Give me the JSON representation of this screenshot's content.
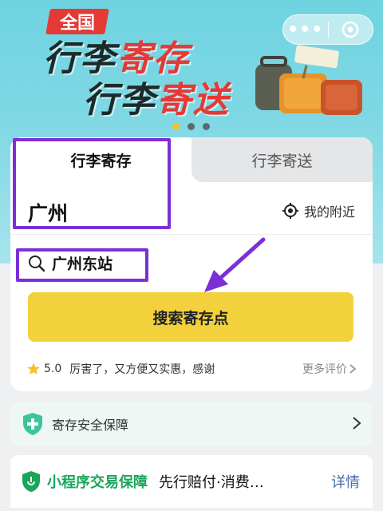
{
  "banner": {
    "badge": "全国",
    "headline_line1_dark": "行李",
    "headline_line1_red": "寄存",
    "headline_line2_dark": "行李",
    "headline_line2_red": "寄送",
    "carousel_count": 3,
    "carousel_active": 1
  },
  "capsule": {
    "more_label": "•••",
    "more_icon": "more-dots-icon",
    "close_icon": "close-target-icon"
  },
  "tabs": [
    {
      "label": "行李寄存",
      "active": true
    },
    {
      "label": "行李寄送",
      "active": false
    }
  ],
  "location": {
    "city": "广州",
    "nearby_label": "我的附近"
  },
  "search": {
    "value": "广州东站",
    "button_label": "搜索寄存点"
  },
  "review": {
    "rating": "5.0",
    "text": "厉害了，又方便又实惠，感谢",
    "more_label": "更多评价"
  },
  "safety": {
    "label": "寄存安全保障"
  },
  "guarantee": {
    "title": "小程序交易保障",
    "desc": "先行赔付·消费…",
    "detail_label": "详情"
  },
  "colors": {
    "accent_yellow": "#f2d13c",
    "highlight_purple": "#7b2fd6",
    "brand_red": "#e53935",
    "guarantee_green": "#1aa55a",
    "link_blue": "#4a6cb0"
  }
}
